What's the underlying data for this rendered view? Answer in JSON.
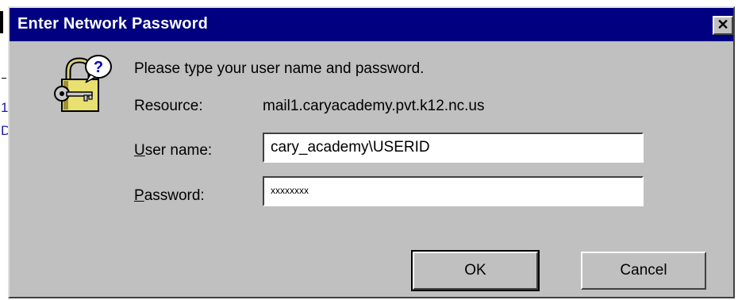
{
  "background": {
    "link1": "1",
    "link2": "D"
  },
  "dialog": {
    "title": "Enter Network Password",
    "close_label": "✕",
    "prompt": "Please type your user name and password.",
    "resource_label": "Resource:",
    "resource_value": "mail1.caryacademy.pvt.k12.nc.us",
    "username_label_underlined": "U",
    "username_label_rest": "ser name:",
    "username_value": "cary_academy\\USERID",
    "password_label_underlined": "P",
    "password_label_rest": "assword:",
    "password_value": "xxxxxxxx",
    "ok_label": "OK",
    "cancel_label": "Cancel",
    "icon": "key-lock-question-icon"
  },
  "colors": {
    "titlebar": "#000080",
    "face": "#c0c0c0"
  }
}
